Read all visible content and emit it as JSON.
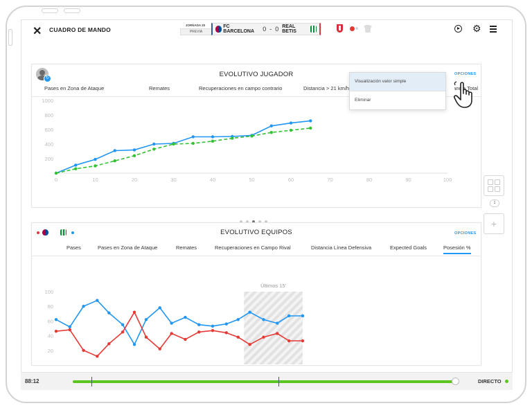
{
  "header": {
    "title": "CUADRO DE MANDO",
    "jornada": "JORNADA 20",
    "previa": "PREVIA",
    "home_team": "FC BARCELONA",
    "home_score": "0",
    "separator": "-",
    "away_score": "0",
    "away_team": "REAL BETIS"
  },
  "card1": {
    "title": "EVOLUTIVO JUGADOR",
    "options_label": "OPCIONES",
    "tabs": [
      "Pases en Zona de Ataque",
      "Remates",
      "Recuperaciones en campo contrario",
      "Distancia > 21 km/h",
      "Distancia Total"
    ],
    "active_tab": 3,
    "pagination": {
      "pages": 5,
      "current": 3
    }
  },
  "dropdown": {
    "items": [
      "Visualización valor simple",
      "Eliminar"
    ],
    "highlighted": 0
  },
  "card2": {
    "title": "EVOLUTIVO EQUIPOS",
    "options_label": "OPCIONES",
    "tabs": [
      "Pases",
      "Pases en Zona de Ataque",
      "Remates",
      "Recuperaciones en Campo Rival",
      "Distancia Línea Defensiva",
      "Expected Goals",
      "Posesión %"
    ],
    "active_tab": 6,
    "highlight_label": "Últimos 15'"
  },
  "side": {
    "page_badge": "1",
    "add_label": "+"
  },
  "bottom": {
    "time": "88:12",
    "live_label": "DIRECTO"
  },
  "colors": {
    "blue": "#2196f3",
    "green": "#33c233",
    "red": "#e53935",
    "progress": "#5cc61f"
  },
  "chart_data": [
    {
      "type": "line",
      "xlim": [
        0,
        100
      ],
      "ylim": [
        0,
        1000
      ],
      "x_ticks": [
        0,
        10,
        20,
        30,
        40,
        50,
        60,
        70,
        80,
        90,
        100
      ],
      "y_ticks": [
        200,
        400,
        600,
        800,
        1000
      ],
      "grid": false,
      "series": [
        {
          "color": "#2196f3",
          "style": "solid",
          "x": [
            0,
            5,
            10,
            15,
            20,
            25,
            30,
            35,
            40,
            45,
            50,
            55,
            60,
            65
          ],
          "y": [
            0,
            110,
            190,
            310,
            320,
            400,
            410,
            500,
            500,
            505,
            520,
            650,
            690,
            720
          ]
        },
        {
          "color": "#33c233",
          "style": "dashed",
          "x": [
            0,
            5,
            10,
            15,
            20,
            25,
            30,
            35,
            40,
            45,
            50,
            55,
            60,
            65
          ],
          "y": [
            0,
            60,
            100,
            170,
            240,
            330,
            400,
            410,
            440,
            480,
            510,
            560,
            590,
            620
          ]
        }
      ]
    },
    {
      "type": "line",
      "xlim": [
        0,
        100
      ],
      "ylim": [
        0,
        100
      ],
      "x_ticks": [
        0,
        10,
        20,
        30,
        40,
        50,
        60,
        70,
        80,
        90,
        100
      ],
      "y_ticks": [
        20,
        40,
        60,
        80,
        100
      ],
      "grid": false,
      "highlight_range": [
        48,
        63
      ],
      "series": [
        {
          "color": "#2196f3",
          "style": "solid",
          "x": [
            0,
            3.5,
            7,
            10.5,
            13.5,
            17,
            20,
            23,
            26.5,
            29.5,
            33,
            36.5,
            40,
            43.5,
            46.5,
            49.5,
            53,
            56.5,
            59.5,
            63
          ],
          "y": [
            62,
            52,
            80,
            88,
            71,
            55,
            28,
            62,
            78,
            57,
            65,
            55,
            53,
            56,
            62,
            72,
            62,
            57,
            67,
            67
          ]
        },
        {
          "color": "#e53935",
          "style": "solid",
          "x": [
            0,
            3.5,
            7,
            10.5,
            13.5,
            17,
            20,
            23,
            26.5,
            29.5,
            33,
            36.5,
            40,
            43.5,
            46.5,
            49.5,
            53,
            56.5,
            59.5,
            63
          ],
          "y": [
            46,
            48,
            20,
            12,
            29,
            45,
            72,
            38,
            22,
            43,
            35,
            45,
            47,
            44,
            38,
            28,
            38,
            43,
            33,
            33
          ]
        }
      ]
    }
  ]
}
